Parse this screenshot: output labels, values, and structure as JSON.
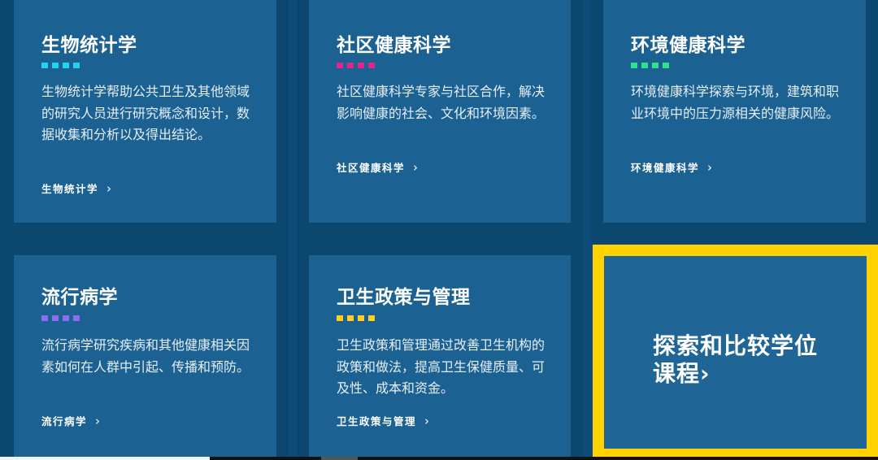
{
  "cards": [
    {
      "title": "生物统计学",
      "dot_color": "#22d3f0",
      "description": "生物统计学帮助公共卫生及其他领域的研究人员进行研究概念和设计，数据收集和分析以及得出结论。",
      "link_label": "生物统计学",
      "link_icon": "chevron-right-icon"
    },
    {
      "title": "社区健康科学",
      "dot_color": "#e0258e",
      "description": "社区健康科学专家与社区合作，解决影响健康的社会、文化和环境因素。",
      "link_label": "社区健康科学",
      "link_icon": "chevron-right-icon"
    },
    {
      "title": "环境健康科学",
      "dot_color": "#2fe08f",
      "description": "环境健康科学探索与环境，建筑和职业环境中的压力源相关的健康风险。",
      "link_label": "环境健康科学",
      "link_icon": "chevron-right-icon"
    },
    {
      "title": "流行病学",
      "dot_color": "#8d6cf0",
      "description": "流行病学研究疾病和其他健康相关因素如何在人群中引起、传播和预防。",
      "link_label": "流行病学",
      "link_icon": "chevron-right-icon"
    },
    {
      "title": "卫生政策与管理",
      "dot_color": "#ffcf1f",
      "description": "卫生政策和管理通过改善卫生机构的政策和做法，提高卫生保健质量、可及性、成本和资金。",
      "link_label": "卫生政策与管理",
      "link_icon": "chevron-right-icon"
    }
  ],
  "cta": {
    "label": "探索和比较学位课程›",
    "border_color": "#ffd200"
  },
  "chevron_glyph": "›"
}
